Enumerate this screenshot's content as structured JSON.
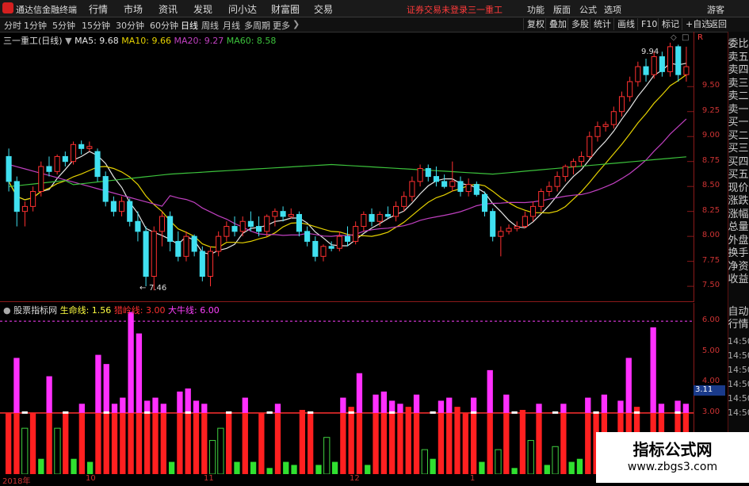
{
  "menubar": {
    "app_title": "通达信金融终端",
    "items": [
      "行情",
      "市场",
      "资讯",
      "发现",
      "问小达",
      "财富圈",
      "交易"
    ],
    "broker_status": "证券交易未登录",
    "stock_name": "三一重工",
    "right_items": [
      "功能",
      "版面",
      "公式",
      "选项"
    ],
    "guest": "游客"
  },
  "toolbar": {
    "periods": [
      "分时",
      "1分钟",
      "5分钟",
      "15分钟",
      "30分钟",
      "60分钟",
      "日线",
      "周线",
      "月线",
      "多周期",
      "更多"
    ],
    "active_period": "日线",
    "right_buttons": [
      "复权",
      "叠加",
      "多股",
      "统计",
      "画线",
      "F10",
      "标记",
      "+自选",
      "返回"
    ]
  },
  "main_chart": {
    "title": "三一重工(日线)",
    "ma_legend": [
      {
        "label": "MA5: 9.68",
        "color": "#e6e6e6"
      },
      {
        "label": "MA10: 9.66",
        "color": "#e6d200"
      },
      {
        "label": "MA20: 9.27",
        "color": "#c040c0"
      },
      {
        "label": "MA60: 8.58",
        "color": "#3cc23c"
      }
    ],
    "high_label": "9.94",
    "low_label": "7.46",
    "scale": [
      "9.50",
      "9.25",
      "9.00",
      "8.75",
      "8.50",
      "8.25",
      "8.00",
      "7.75",
      "7.50"
    ],
    "top_mark": "R"
  },
  "sub_chart": {
    "title": "股票指标网",
    "legend": [
      {
        "label": "生命线: 1.56",
        "color": "#ffff40"
      },
      {
        "label": "猎岭线: 3.00",
        "color": "#ff3030"
      },
      {
        "label": "大牛线: 6.00",
        "color": "#ff40ff"
      }
    ],
    "scale": [
      "6.00",
      "5.00",
      "4.00",
      "3.00",
      "2.00"
    ],
    "current_value": "3.11"
  },
  "x_axis": [
    "2018年",
    "10",
    "11",
    "12",
    "1"
  ],
  "right_panel": {
    "items": [
      "委比",
      "卖五",
      "卖四",
      "卖三",
      "卖二",
      "卖一",
      "买一",
      "买二",
      "买三",
      "买四",
      "买五",
      "现价",
      "涨跌",
      "涨幅",
      "总量",
      "外盘",
      "换手",
      "净资",
      "收益"
    ],
    "lower": [
      "自动",
      "行情"
    ],
    "times": [
      "14:50",
      "14:50",
      "14:50",
      "14:50",
      "14:50",
      "14:50"
    ]
  },
  "watermark": {
    "title": "指标公式网",
    "url": "www.zbgs3.com"
  },
  "colors": {
    "up": "#ff3030",
    "down": "#40e0f0",
    "ma5": "#e6e6e6",
    "ma10": "#e6d200",
    "ma20": "#c040c0",
    "ma60": "#3cc23c",
    "grid": "#8b1a1a"
  },
  "chart_data": {
    "type": "candlestick",
    "candles": [
      {
        "o": 8.8,
        "h": 8.88,
        "l": 8.45,
        "c": 8.55
      },
      {
        "o": 8.55,
        "h": 8.6,
        "l": 8.1,
        "c": 8.25
      },
      {
        "o": 8.25,
        "h": 8.35,
        "l": 8.1,
        "c": 8.3
      },
      {
        "o": 8.3,
        "h": 8.5,
        "l": 8.25,
        "c": 8.45
      },
      {
        "o": 8.45,
        "h": 8.75,
        "l": 8.4,
        "c": 8.7
      },
      {
        "o": 8.7,
        "h": 8.8,
        "l": 8.6,
        "c": 8.65
      },
      {
        "o": 8.65,
        "h": 8.82,
        "l": 8.62,
        "c": 8.8
      },
      {
        "o": 8.8,
        "h": 8.85,
        "l": 8.7,
        "c": 8.75
      },
      {
        "o": 8.75,
        "h": 8.95,
        "l": 8.72,
        "c": 8.92
      },
      {
        "o": 8.92,
        "h": 8.96,
        "l": 8.82,
        "c": 8.88
      },
      {
        "o": 8.88,
        "h": 8.95,
        "l": 8.85,
        "c": 8.9
      },
      {
        "o": 8.85,
        "h": 8.88,
        "l": 8.55,
        "c": 8.6
      },
      {
        "o": 8.6,
        "h": 8.65,
        "l": 8.3,
        "c": 8.35
      },
      {
        "o": 8.35,
        "h": 8.4,
        "l": 8.2,
        "c": 8.25
      },
      {
        "o": 8.25,
        "h": 8.4,
        "l": 8.2,
        "c": 8.35
      },
      {
        "o": 8.35,
        "h": 8.38,
        "l": 8.1,
        "c": 8.15
      },
      {
        "o": 8.15,
        "h": 8.25,
        "l": 7.95,
        "c": 8.05
      },
      {
        "o": 8.05,
        "h": 8.1,
        "l": 7.5,
        "c": 7.6
      },
      {
        "o": 7.6,
        "h": 8.1,
        "l": 7.46,
        "c": 8.05
      },
      {
        "o": 8.05,
        "h": 8.25,
        "l": 7.9,
        "c": 8.2
      },
      {
        "o": 8.2,
        "h": 8.25,
        "l": 7.85,
        "c": 7.95
      },
      {
        "o": 7.95,
        "h": 8.05,
        "l": 7.75,
        "c": 7.8
      },
      {
        "o": 7.8,
        "h": 8.05,
        "l": 7.75,
        "c": 8.0
      },
      {
        "o": 8.0,
        "h": 8.02,
        "l": 7.8,
        "c": 7.85
      },
      {
        "o": 7.85,
        "h": 7.9,
        "l": 7.55,
        "c": 7.6
      },
      {
        "o": 7.6,
        "h": 7.9,
        "l": 7.5,
        "c": 7.85
      },
      {
        "o": 7.85,
        "h": 8.05,
        "l": 7.8,
        "c": 8.0
      },
      {
        "o": 8.0,
        "h": 8.15,
        "l": 7.95,
        "c": 8.1
      },
      {
        "o": 8.1,
        "h": 8.2,
        "l": 8.0,
        "c": 8.05
      },
      {
        "o": 8.05,
        "h": 8.2,
        "l": 8.0,
        "c": 8.15
      },
      {
        "o": 8.15,
        "h": 8.25,
        "l": 8.05,
        "c": 8.1
      },
      {
        "o": 8.1,
        "h": 8.2,
        "l": 8.0,
        "c": 8.05
      },
      {
        "o": 8.05,
        "h": 8.22,
        "l": 8.0,
        "c": 8.2
      },
      {
        "o": 8.2,
        "h": 8.28,
        "l": 8.1,
        "c": 8.25
      },
      {
        "o": 8.25,
        "h": 8.3,
        "l": 8.15,
        "c": 8.2
      },
      {
        "o": 8.2,
        "h": 8.28,
        "l": 8.18,
        "c": 8.22
      },
      {
        "o": 8.22,
        "h": 8.25,
        "l": 8.0,
        "c": 8.05
      },
      {
        "o": 8.05,
        "h": 8.1,
        "l": 7.9,
        "c": 7.95
      },
      {
        "o": 7.95,
        "h": 8.0,
        "l": 7.75,
        "c": 7.8
      },
      {
        "o": 7.8,
        "h": 7.92,
        "l": 7.75,
        "c": 7.9
      },
      {
        "o": 7.9,
        "h": 7.95,
        "l": 7.85,
        "c": 7.88
      },
      {
        "o": 7.88,
        "h": 8.05,
        "l": 7.85,
        "c": 8.0
      },
      {
        "o": 8.0,
        "h": 8.1,
        "l": 7.9,
        "c": 7.95
      },
      {
        "o": 7.95,
        "h": 8.15,
        "l": 7.92,
        "c": 8.1
      },
      {
        "o": 8.1,
        "h": 8.25,
        "l": 8.05,
        "c": 8.22
      },
      {
        "o": 8.22,
        "h": 8.28,
        "l": 8.1,
        "c": 8.15
      },
      {
        "o": 8.15,
        "h": 8.25,
        "l": 8.1,
        "c": 8.22
      },
      {
        "o": 8.22,
        "h": 8.3,
        "l": 8.18,
        "c": 8.2
      },
      {
        "o": 8.2,
        "h": 8.35,
        "l": 8.15,
        "c": 8.3
      },
      {
        "o": 8.3,
        "h": 8.45,
        "l": 8.25,
        "c": 8.4
      },
      {
        "o": 8.4,
        "h": 8.6,
        "l": 8.35,
        "c": 8.55
      },
      {
        "o": 8.55,
        "h": 8.72,
        "l": 8.5,
        "c": 8.68
      },
      {
        "o": 8.68,
        "h": 8.72,
        "l": 8.55,
        "c": 8.6
      },
      {
        "o": 8.6,
        "h": 8.7,
        "l": 8.5,
        "c": 8.55
      },
      {
        "o": 8.55,
        "h": 8.62,
        "l": 8.48,
        "c": 8.5
      },
      {
        "o": 8.5,
        "h": 8.75,
        "l": 8.45,
        "c": 8.55
      },
      {
        "o": 8.55,
        "h": 8.6,
        "l": 8.4,
        "c": 8.45
      },
      {
        "o": 8.45,
        "h": 8.58,
        "l": 8.4,
        "c": 8.52
      },
      {
        "o": 8.52,
        "h": 8.55,
        "l": 8.4,
        "c": 8.42
      },
      {
        "o": 8.42,
        "h": 8.45,
        "l": 8.2,
        "c": 8.25
      },
      {
        "o": 8.25,
        "h": 8.28,
        "l": 7.95,
        "c": 8.0
      },
      {
        "o": 8.0,
        "h": 8.1,
        "l": 7.8,
        "c": 8.05
      },
      {
        "o": 8.05,
        "h": 8.12,
        "l": 8.02,
        "c": 8.08
      },
      {
        "o": 8.08,
        "h": 8.15,
        "l": 8.05,
        "c": 8.1
      },
      {
        "o": 8.1,
        "h": 8.25,
        "l": 8.08,
        "c": 8.2
      },
      {
        "o": 8.2,
        "h": 8.35,
        "l": 8.15,
        "c": 8.3
      },
      {
        "o": 8.3,
        "h": 8.48,
        "l": 8.25,
        "c": 8.45
      },
      {
        "o": 8.45,
        "h": 8.55,
        "l": 8.4,
        "c": 8.5
      },
      {
        "o": 8.5,
        "h": 8.65,
        "l": 8.45,
        "c": 8.6
      },
      {
        "o": 8.6,
        "h": 8.72,
        "l": 8.55,
        "c": 8.7
      },
      {
        "o": 8.7,
        "h": 8.78,
        "l": 8.62,
        "c": 8.75
      },
      {
        "o": 8.75,
        "h": 8.85,
        "l": 8.7,
        "c": 8.8
      },
      {
        "o": 8.8,
        "h": 9.05,
        "l": 8.78,
        "c": 9.0
      },
      {
        "o": 9.0,
        "h": 9.15,
        "l": 8.95,
        "c": 9.1
      },
      {
        "o": 9.1,
        "h": 9.15,
        "l": 9.05,
        "c": 9.12
      },
      {
        "o": 9.12,
        "h": 9.3,
        "l": 9.08,
        "c": 9.25
      },
      {
        "o": 9.25,
        "h": 9.45,
        "l": 9.2,
        "c": 9.4
      },
      {
        "o": 9.4,
        "h": 9.6,
        "l": 9.35,
        "c": 9.55
      },
      {
        "o": 9.55,
        "h": 9.75,
        "l": 9.5,
        "c": 9.7
      },
      {
        "o": 9.7,
        "h": 9.78,
        "l": 9.55,
        "c": 9.62
      },
      {
        "o": 9.62,
        "h": 9.85,
        "l": 9.58,
        "c": 9.8
      },
      {
        "o": 9.8,
        "h": 9.85,
        "l": 9.6,
        "c": 9.65
      },
      {
        "o": 9.65,
        "h": 9.94,
        "l": 9.6,
        "c": 9.9
      },
      {
        "o": 9.9,
        "h": 9.92,
        "l": 9.55,
        "c": 9.62
      },
      {
        "o": 9.62,
        "h": 9.9,
        "l": 9.55,
        "c": 9.7
      }
    ],
    "ylim": [
      7.35,
      10.05
    ],
    "indicator": {
      "bars": [
        3.0,
        4.8,
        2.5,
        3.0,
        1.5,
        4.2,
        2.5,
        3.0,
        1.5,
        3.3,
        1.4,
        4.9,
        4.6,
        3.3,
        3.5,
        6.3,
        5.6,
        3.4,
        3.5,
        3.3,
        1.4,
        3.7,
        3.8,
        3.4,
        3.3,
        2.1,
        2.5,
        3.0,
        1.4,
        3.5,
        1.4,
        3.0,
        1.2,
        3.3,
        1.4,
        1.3,
        3.1,
        3.0,
        1.3,
        2.2,
        1.4,
        3.5,
        3.2,
        4.3,
        1.3,
        3.6,
        3.7,
        3.4,
        3.3,
        3.2,
        3.6,
        1.8,
        1.5,
        3.4,
        3.5,
        3.2,
        3.0,
        3.5,
        1.4,
        4.4,
        1.8,
        3.6,
        1.2,
        3.1,
        2.1,
        3.3,
        1.3,
        1.9,
        3.3,
        1.4,
        1.5,
        3.5,
        3.0,
        3.6,
        1.3,
        3.4,
        4.8,
        3.2,
        1.4,
        5.8,
        3.3,
        1.6,
        3.4,
        3.3
      ],
      "ylim": [
        1.0,
        6.6
      ],
      "levels": [
        6.0,
        3.0
      ]
    }
  }
}
